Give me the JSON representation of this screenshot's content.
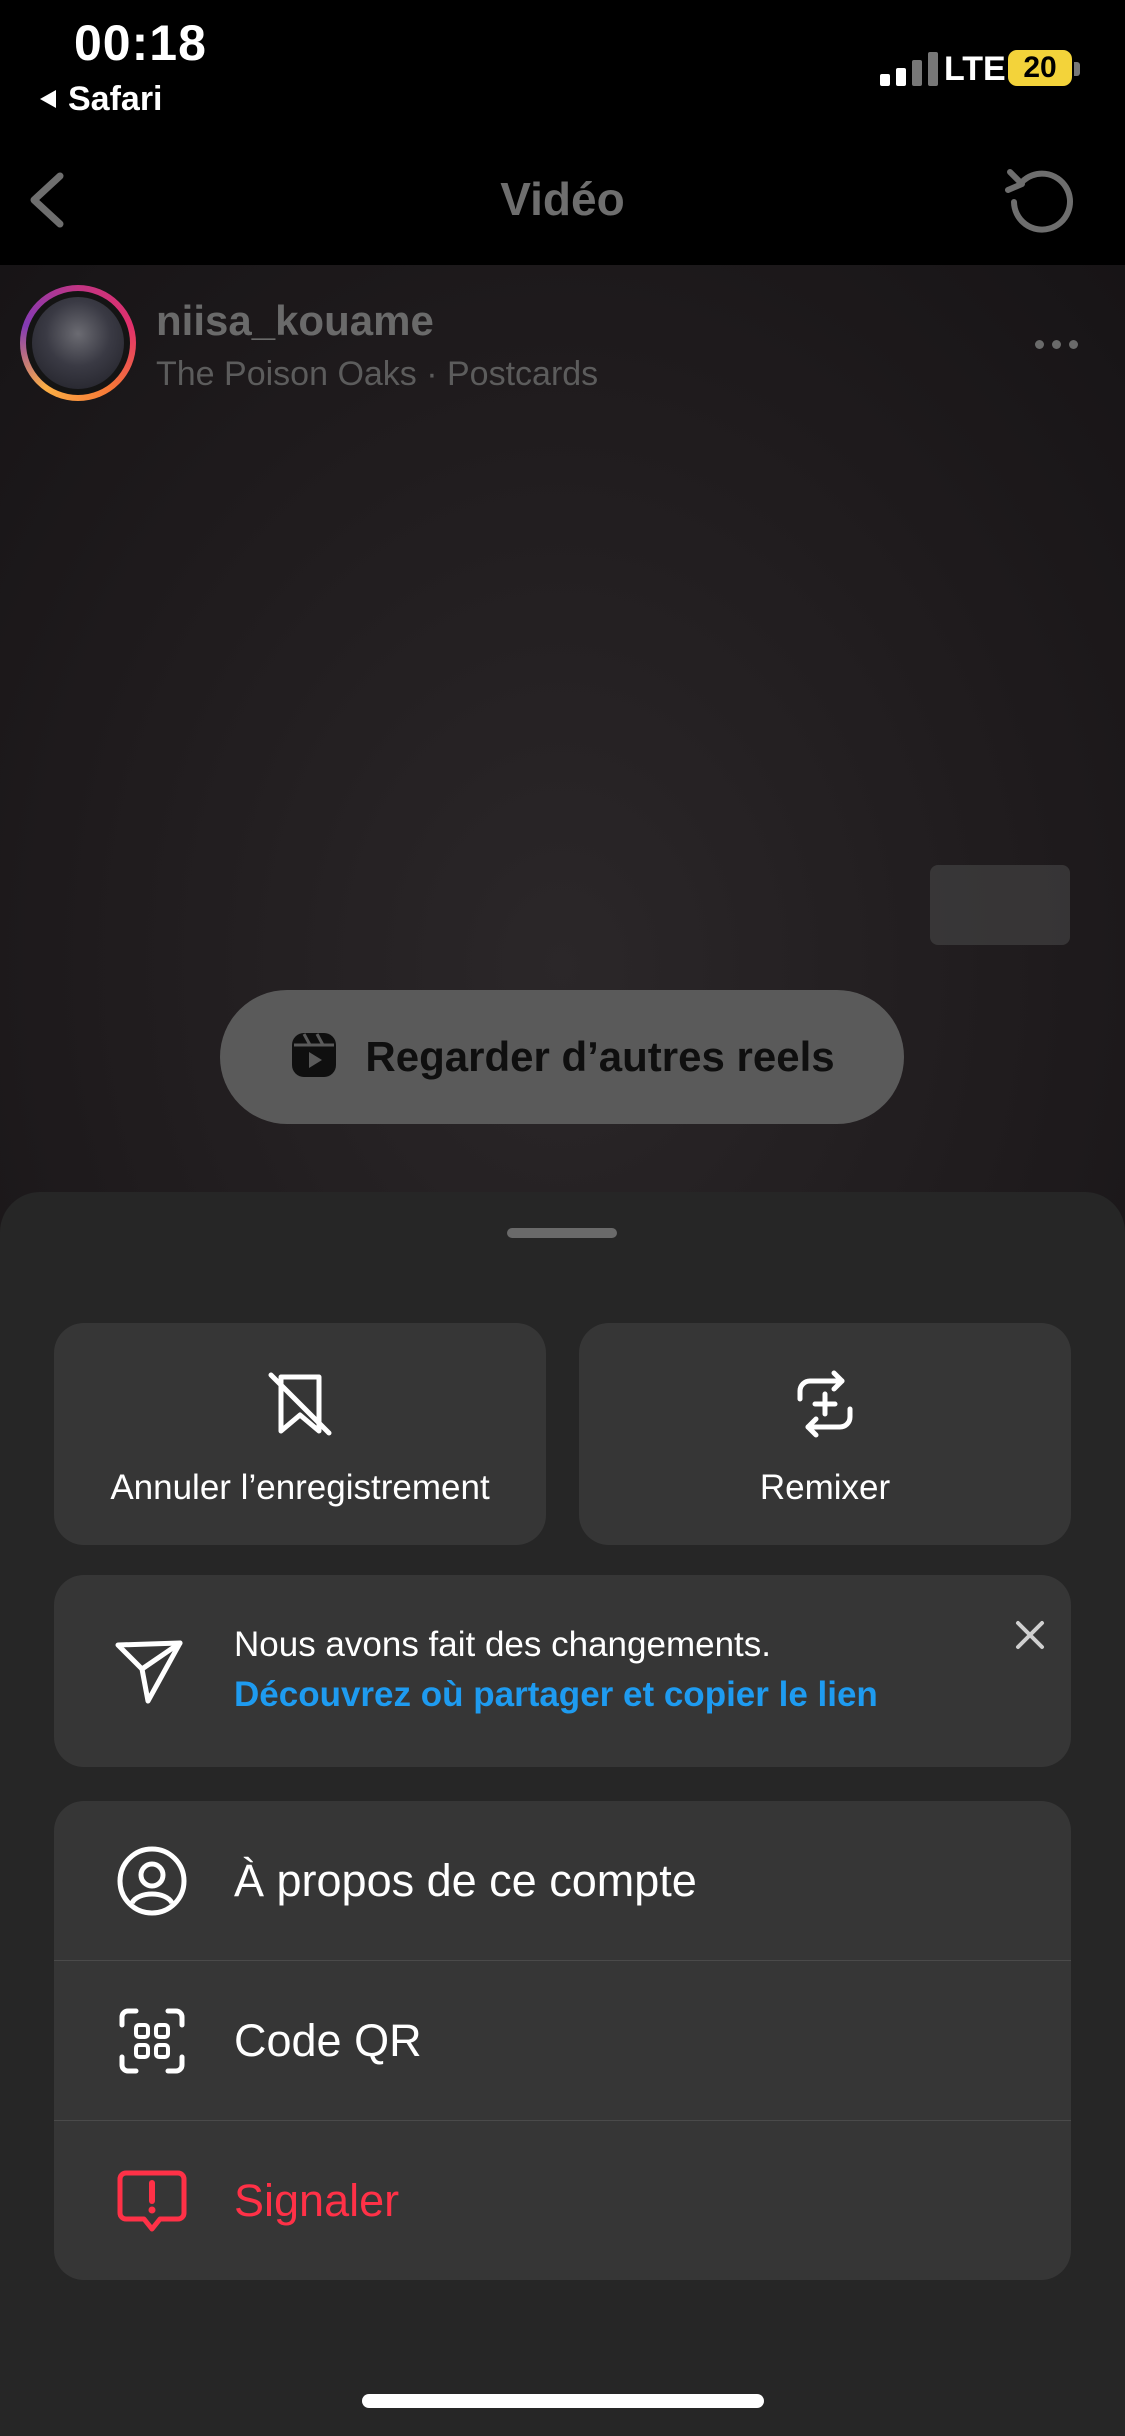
{
  "status_bar": {
    "time": "00:18",
    "back_app": "Safari",
    "network": "LTE",
    "battery": "20",
    "battery_color": "#f3d33a"
  },
  "nav": {
    "title": "Vidéo",
    "back_icon": "chevron-left-icon",
    "refresh_icon": "refresh-icon"
  },
  "post": {
    "username": "niisa_kouame",
    "audio": "The Poison Oaks · Postcards",
    "watch_more_label": "Regarder d’autres reels"
  },
  "sheet": {
    "actions": [
      {
        "label": "Annuler l’enregistrement",
        "icon": "unsave-bookmark-icon"
      },
      {
        "label": "Remixer",
        "icon": "remix-icon"
      }
    ],
    "notice": {
      "line1": "Nous avons fait des changements.",
      "line2": "Découvrez où partager et copier le lien",
      "link_color": "#1e9bf0"
    },
    "menu": [
      {
        "label": "À propos de ce compte",
        "icon": "account-circle-icon"
      },
      {
        "label": "Code QR",
        "icon": "qr-code-icon"
      },
      {
        "label": "Signaler",
        "icon": "report-icon",
        "color": "#ff3147"
      }
    ]
  }
}
